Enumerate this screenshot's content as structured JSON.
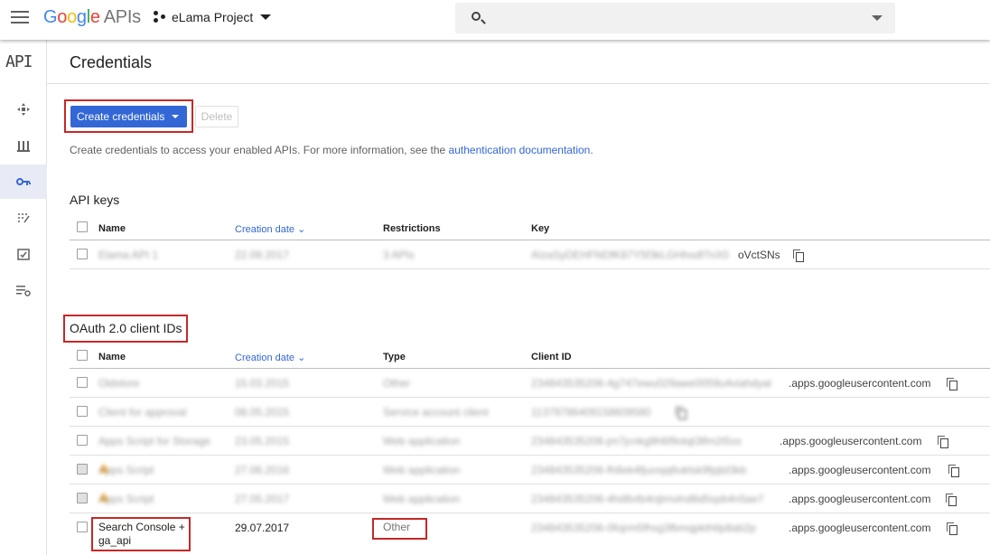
{
  "header": {
    "logo": {
      "g": "G",
      "o1": "o",
      "o2": "o",
      "g2": "g",
      "l": "l",
      "e": "e",
      "apis": "APIs"
    },
    "project": "eLama Project",
    "search_placeholder": ""
  },
  "rail": {
    "api_logo": "API"
  },
  "page": {
    "title": "Credentials"
  },
  "toolbar": {
    "create_label": "Create credentials",
    "delete_label": "Delete"
  },
  "info": {
    "text": "Create credentials to access your enabled APIs. For more information, see the ",
    "link": "authentication documentation",
    "suffix": "."
  },
  "api_keys": {
    "title": "API keys",
    "columns": {
      "name": "Name",
      "date": "Creation date",
      "restrictions": "Restrictions",
      "key": "Key"
    },
    "rows": [
      {
        "name": "Elama API 1",
        "date": "22.08.2017",
        "restrictions": "3 APIs",
        "key_hidden": "AIzaSyDEHFNDfK87Y5f3kLGHhsdf7nX0",
        "key_visible": "oVctSNs"
      }
    ]
  },
  "oauth": {
    "title": "OAuth 2.0 client IDs",
    "columns": {
      "name": "Name",
      "date": "Creation date",
      "type": "Type",
      "client": "Client ID"
    },
    "rows": [
      {
        "name": "Oldstore",
        "date": "15.03.2015",
        "type": "Other",
        "client_hidden": "234843535206-4g747ewu029awe0059u4viahdyal",
        "client_visible": ".apps.googleusercontent.com",
        "warn": false,
        "copy": true
      },
      {
        "name": "Client for approval",
        "date": "08.05.2015",
        "type": "Service account client",
        "client_hidden": "11379786409158609580",
        "client_visible": "",
        "warn": false,
        "copy": true
      },
      {
        "name": "Apps Script for Storage",
        "date": "23.05.2015",
        "type": "Web application",
        "client_hidden": "234843535206-jm7jcnkg9h6f9otqt3lfm2t5ss",
        "client_visible": ".apps.googleusercontent.com",
        "warn": false,
        "copy": true
      },
      {
        "name": "Apps Script",
        "date": "27.06.2016",
        "type": "Web application",
        "client_hidden": "234843535206-fh8ek4fjuosjq6uktsk9fpjtd3kb",
        "client_visible": ".apps.googleusercontent.com",
        "warn": true,
        "copy": true
      },
      {
        "name": "Apps Script",
        "date": "27.05.2017",
        "type": "Web application",
        "client_hidden": "234843535206-4hd8vtb4njtmvlnd8d5spb4n5ae7",
        "client_visible": ".apps.googleusercontent.com",
        "warn": true,
        "copy": true
      },
      {
        "name": "Search Console + ga_api",
        "date": "29.07.2017",
        "type": "Other",
        "client_hidden": "234843535206-0fojrm5fhsg3fbmqpkthtlp8ab2p",
        "client_visible": ".apps.googleusercontent.com",
        "warn": false,
        "copy": true
      }
    ]
  }
}
